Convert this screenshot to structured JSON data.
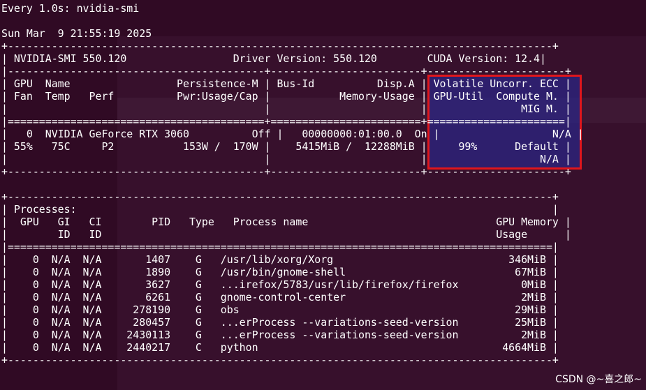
{
  "header": {
    "watch_line": "Every 1.0s: nvidia-smi",
    "timestamp": "Sun Mar  9 21:55:19 2025"
  },
  "smi": {
    "version_label": "NVIDIA-SMI 550.120",
    "driver_label": "Driver Version: 550.120",
    "cuda_label": "CUDA Version: 12.4"
  },
  "gpu": {
    "index": "0",
    "name": "NVIDIA GeForce RTX 3060",
    "persistence": "Off",
    "bus_id": "00000000:01:00.0",
    "disp_a": "On",
    "ecc": "N/A",
    "fan": "55%",
    "temp": "75C",
    "perf": "P2",
    "power_usage": "153W",
    "power_cap": "170W",
    "mem_used": "5415MiB",
    "mem_total": "12288MiB",
    "util": "99%",
    "compute_mode": "Default",
    "mig": "N/A"
  },
  "processes": [
    {
      "gpu": "0",
      "gi": "N/A",
      "ci": "N/A",
      "pid": "1407",
      "type": "G",
      "name": "/usr/lib/xorg/Xorg",
      "mem": "346MiB"
    },
    {
      "gpu": "0",
      "gi": "N/A",
      "ci": "N/A",
      "pid": "1890",
      "type": "G",
      "name": "/usr/bin/gnome-shell",
      "mem": "67MiB"
    },
    {
      "gpu": "0",
      "gi": "N/A",
      "ci": "N/A",
      "pid": "3627",
      "type": "G",
      "name": "...irefox/5783/usr/lib/firefox/firefox",
      "mem": "0MiB"
    },
    {
      "gpu": "0",
      "gi": "N/A",
      "ci": "N/A",
      "pid": "6261",
      "type": "G",
      "name": "gnome-control-center",
      "mem": "2MiB"
    },
    {
      "gpu": "0",
      "gi": "N/A",
      "ci": "N/A",
      "pid": "278190",
      "type": "G",
      "name": "obs",
      "mem": "29MiB"
    },
    {
      "gpu": "0",
      "gi": "N/A",
      "ci": "N/A",
      "pid": "280457",
      "type": "G",
      "name": "...erProcess --variations-seed-version",
      "mem": "25MiB"
    },
    {
      "gpu": "0",
      "gi": "N/A",
      "ci": "N/A",
      "pid": "2430113",
      "type": "G",
      "name": "...erProcess --variations-seed-version",
      "mem": "2MiB"
    },
    {
      "gpu": "0",
      "gi": "N/A",
      "ci": "N/A",
      "pid": "2440217",
      "type": "C",
      "name": "python",
      "mem": "4664MiB"
    }
  ],
  "watermark": "CSDN @~喜之郎~",
  "colors": {
    "background": "#300a24",
    "text": "#ffffff",
    "highlight_border": "#e0161c"
  }
}
